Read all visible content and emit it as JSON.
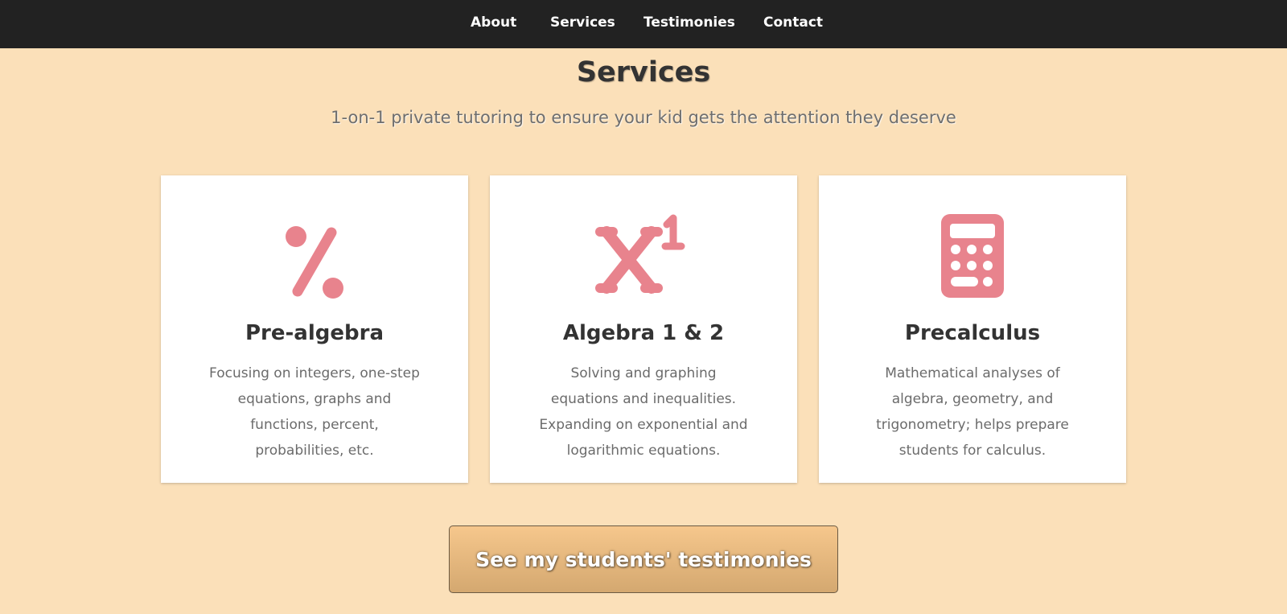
{
  "nav": {
    "items": [
      {
        "label": "About"
      },
      {
        "label": "Services"
      },
      {
        "label": "Testimonies"
      },
      {
        "label": "Contact"
      }
    ]
  },
  "services": {
    "title": "Services",
    "subtitle": "1-on-1 private tutoring to ensure your kid gets the attention they deserve",
    "cards": [
      {
        "icon": "percent-icon",
        "title": "Pre-algebra",
        "description": "Focusing on integers, one-step equations, graphs and functions, percent, probabilities, etc."
      },
      {
        "icon": "superscript-icon",
        "title": "Algebra 1 & 2",
        "description": "Solving and graphing equations and inequalities. Expanding on exponential and logarithmic equations."
      },
      {
        "icon": "calculator-icon",
        "title": "Precalculus",
        "description": "Mathematical analyses of algebra, geometry, and trigonometry; helps prepare students for calculus."
      }
    ]
  },
  "cta": {
    "label": "See my students' testimonies"
  },
  "colors": {
    "page_background": "#fbe0b9",
    "navbar": "#222222",
    "icon_accent": "#e8838d",
    "button_gradient_top": "#f6c78c",
    "button_gradient_bottom": "#d4a870"
  }
}
